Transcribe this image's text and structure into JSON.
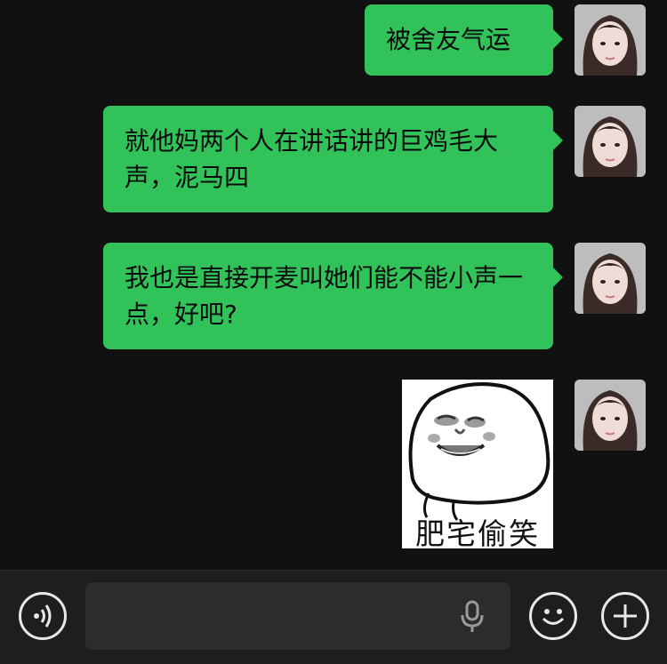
{
  "messages": [
    {
      "type": "text",
      "text": "被舍友气运"
    },
    {
      "type": "text",
      "text": "就他妈两个人在讲话讲的巨鸡毛大声，泥马四"
    },
    {
      "type": "text",
      "text": "我也是直接开麦叫她们能不能小声一点，好吧?"
    },
    {
      "type": "sticker",
      "caption": "肥宅偷笑",
      "icon": "laughing-blob-face"
    }
  ],
  "toolbar": {
    "voice_icon": "voice-mode-icon",
    "mic_icon": "microphone-icon",
    "emoji_icon": "emoji-icon",
    "plus_icon": "plus-icon",
    "input_value": ""
  },
  "colors": {
    "background": "#111111",
    "bubble": "#31c25a",
    "toolbar": "#1e1e1e"
  }
}
